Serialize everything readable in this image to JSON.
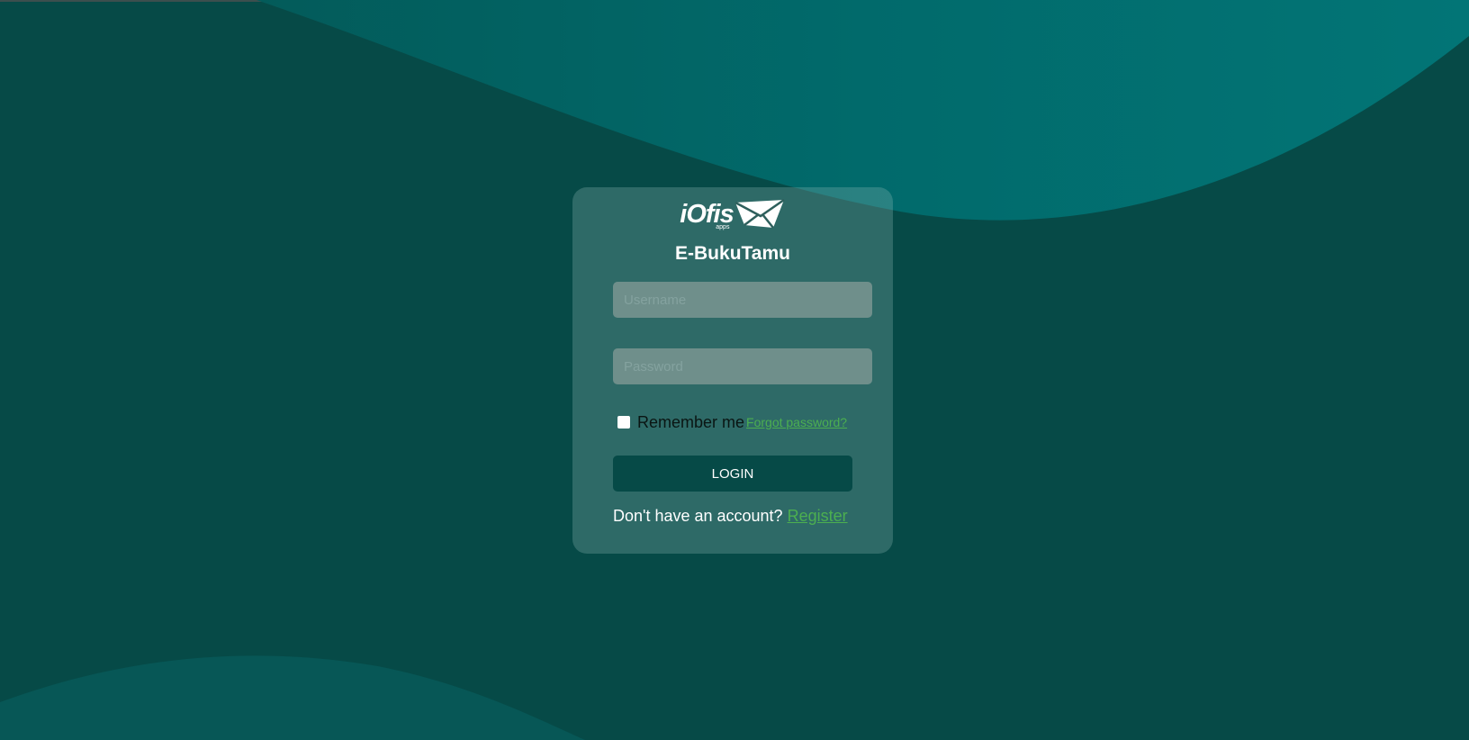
{
  "app": {
    "logo_text": "iOfis",
    "logo_subtext": "apps",
    "title": "E-BukuTamu"
  },
  "form": {
    "username_placeholder": "Username",
    "password_placeholder": "Password",
    "remember_label": "Remember me",
    "forgot_link": "Forgot password?",
    "login_label": "LOGIN",
    "signup_prompt": "Don't have an account? ",
    "register_link": "Register"
  },
  "colors": {
    "background": "#064a47",
    "wave": "#016a6b",
    "card": "#2e5f5c",
    "input": "#6f8f8b",
    "button": "#064a47",
    "link": "#4caf50"
  }
}
